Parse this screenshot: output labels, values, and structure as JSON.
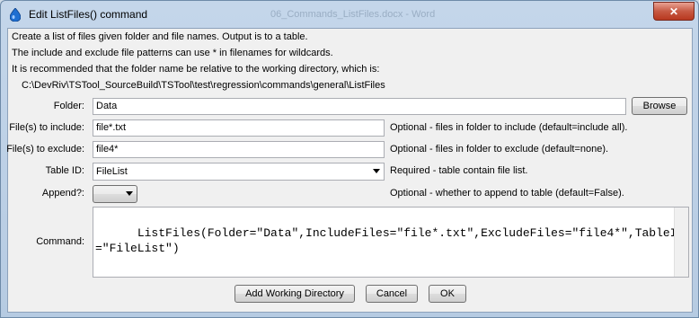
{
  "window": {
    "title": "Edit ListFiles() command",
    "background_title": "06_Commands_ListFiles.docx - Word",
    "close_symbol": "✕"
  },
  "description": {
    "line1": "Create a list of files given folder and file names.  Output is to a table.",
    "line2": "The include and exclude file patterns can use * in filenames for wildcards.",
    "line3": "It is recommended that the folder name be relative to the working directory, which is:",
    "working_dir": "C:\\DevRiv\\TSTool_SourceBuild\\TSTool\\test\\regression\\commands\\general\\ListFiles"
  },
  "form": {
    "folder": {
      "label": "Folder:",
      "value": "Data",
      "browse_label": "Browse"
    },
    "include": {
      "label": "File(s) to include:",
      "value": "file*.txt",
      "note": "Optional - files in folder to include (default=include all)."
    },
    "exclude": {
      "label": "File(s) to exclude:",
      "value": "file4*",
      "note": "Optional - files in folder to exclude (default=none)."
    },
    "table_id": {
      "label": "Table ID:",
      "value": "FileList",
      "note": "Required - table contain file list."
    },
    "append": {
      "label": "Append?:",
      "value": "",
      "note": "Optional - whether to append to table (default=False)."
    },
    "command": {
      "label": "Command:",
      "value": "ListFiles(Folder=\"Data\",IncludeFiles=\"file*.txt\",ExcludeFiles=\"file4*\",TableID=\"FileList\")"
    }
  },
  "buttons": {
    "add_working_dir": "Add Working Directory",
    "cancel": "Cancel",
    "ok": "OK"
  },
  "colors": {
    "window_frame": "#b6cbe2",
    "close_button": "#c75a44",
    "client_bg": "#f0f0f0"
  }
}
